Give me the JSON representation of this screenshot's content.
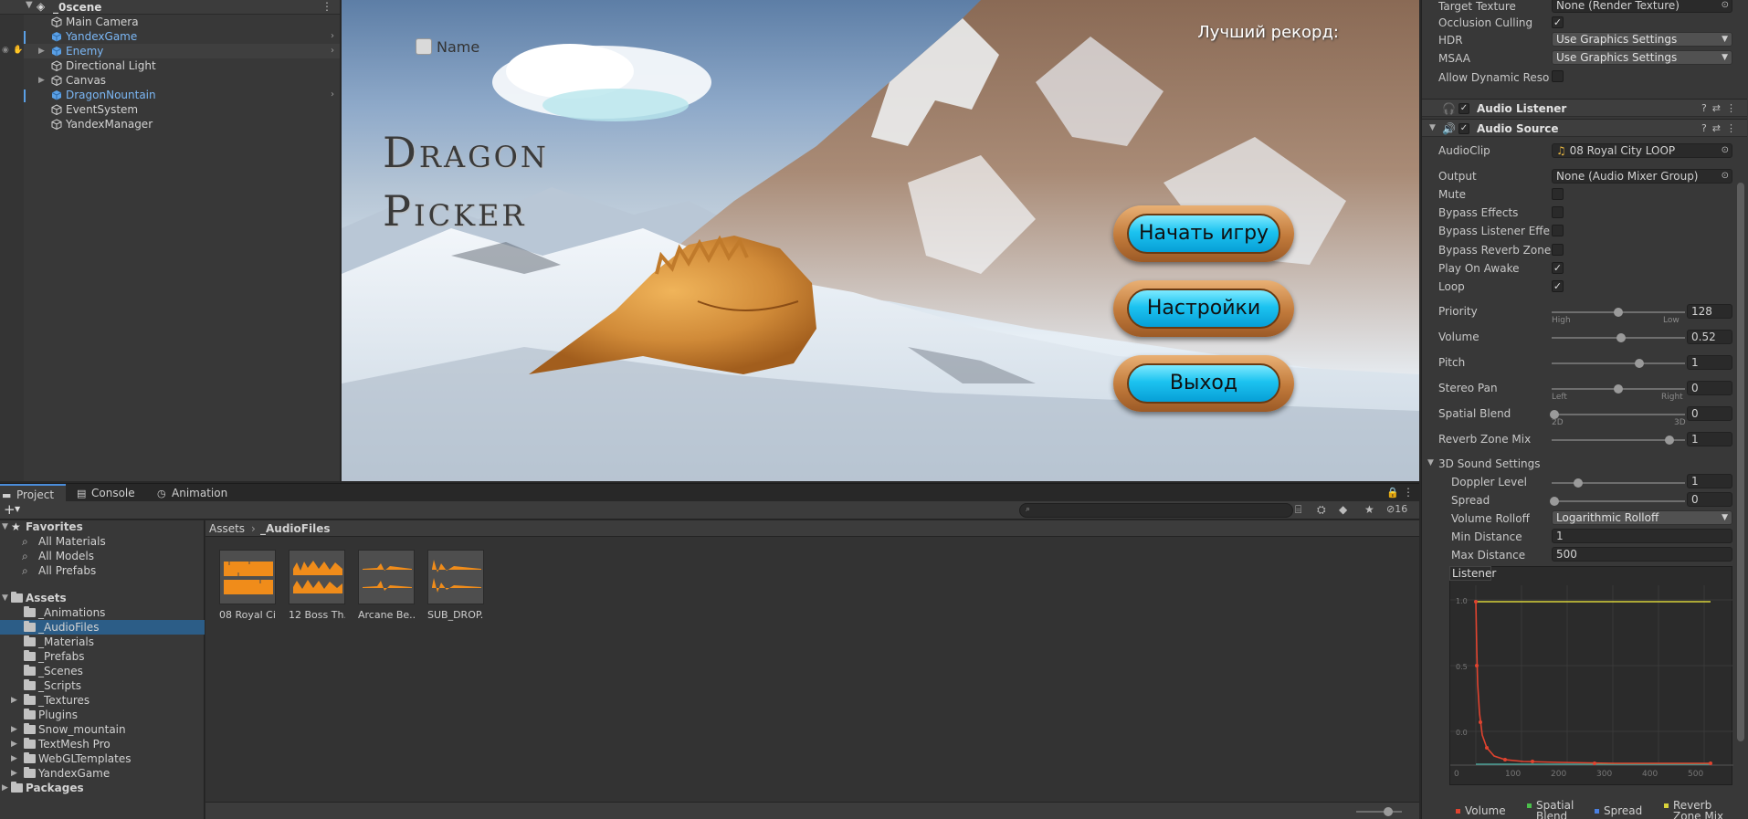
{
  "hierarchy": {
    "scene": "_0scene",
    "items": [
      {
        "label": "Main Camera"
      },
      {
        "label": "YandexGame"
      },
      {
        "label": "Enemy"
      },
      {
        "label": "Directional Light"
      },
      {
        "label": "Canvas"
      },
      {
        "label": "DragonNountain"
      },
      {
        "label": "EventSystem"
      },
      {
        "label": "YandexManager"
      }
    ]
  },
  "game": {
    "title_line1": "Dragon",
    "title_line2": "Picker",
    "name_label": "Name",
    "record_label": "Лучший рекорд:",
    "buttons": [
      "Начать игру",
      "Настройки",
      "Выход"
    ]
  },
  "inspector": {
    "camera": {
      "target_texture_label": "Target Texture",
      "target_texture_value": "None (Render Texture)",
      "occlusion_label": "Occlusion Culling",
      "hdr_label": "HDR",
      "hdr_value": "Use Graphics Settings",
      "msaa_label": "MSAA",
      "msaa_value": "Use Graphics Settings",
      "dynres_label": "Allow Dynamic Resolu"
    },
    "audio_listener": "Audio Listener",
    "audio_source": {
      "title": "Audio Source",
      "audioclip_label": "AudioClip",
      "audioclip_value": "08 Royal City LOOP",
      "output_label": "Output",
      "output_value": "None (Audio Mixer Group)",
      "mute": "Mute",
      "bypass_effects": "Bypass Effects",
      "bypass_listener": "Bypass Listener Effec",
      "bypass_reverb": "Bypass Reverb Zones",
      "play_on_awake": "Play On Awake",
      "loop": "Loop",
      "priority_label": "Priority",
      "priority_value": "128",
      "priority_min": "High",
      "priority_max": "Low",
      "volume_label": "Volume",
      "volume_value": "0.52",
      "pitch_label": "Pitch",
      "pitch_value": "1",
      "stereo_label": "Stereo Pan",
      "stereo_value": "0",
      "stereo_min": "Left",
      "stereo_max": "Right",
      "spatial_label": "Spatial Blend",
      "spatial_value": "0",
      "spatial_min": "2D",
      "spatial_max": "3D",
      "reverb_mix_label": "Reverb Zone Mix",
      "reverb_mix_value": "1",
      "sound3d_header": "3D Sound Settings",
      "doppler_label": "Doppler Level",
      "doppler_value": "1",
      "spread_label": "Spread",
      "spread_value": "0",
      "rolloff_label": "Volume Rolloff",
      "rolloff_value": "Logarithmic Rolloff",
      "min_dist_label": "Min Distance",
      "min_dist_value": "1",
      "max_dist_label": "Max Distance",
      "max_dist_value": "500"
    },
    "curve": {
      "tab": "Listener",
      "y_ticks": [
        "1.0",
        "0.5",
        "0.0"
      ],
      "x_ticks": [
        "0",
        "100",
        "200",
        "300",
        "400",
        "500"
      ],
      "legend": [
        "Volume",
        "Spatial Blend",
        "Spread",
        "Reverb Zone Mix"
      ],
      "legend_colors": [
        "#e0432f",
        "#4bbf4b",
        "#4a7fe0",
        "#d8d23a"
      ]
    }
  },
  "project": {
    "tabs": [
      "Project",
      "Console",
      "Animation"
    ],
    "hidden_count": "16",
    "favorites": "Favorites",
    "fav_items": [
      "All Materials",
      "All Models",
      "All Prefabs"
    ],
    "assets_root": "Assets",
    "folders": [
      "_Animations",
      "_AudioFiles",
      "_Materials",
      "_Prefabs",
      "_Scenes",
      "_Scripts",
      "_Textures",
      "Plugins",
      "Snow_mountain",
      "TextMesh Pro",
      "WebGLTemplates",
      "YandexGame"
    ],
    "packages": "Packages",
    "breadcrumb_root": "Assets",
    "breadcrumb_current": "_AudioFiles",
    "assets": [
      "08 Royal Ci...",
      "12 Boss Th...",
      "Arcane Be...",
      "SUB_DROP..."
    ]
  }
}
